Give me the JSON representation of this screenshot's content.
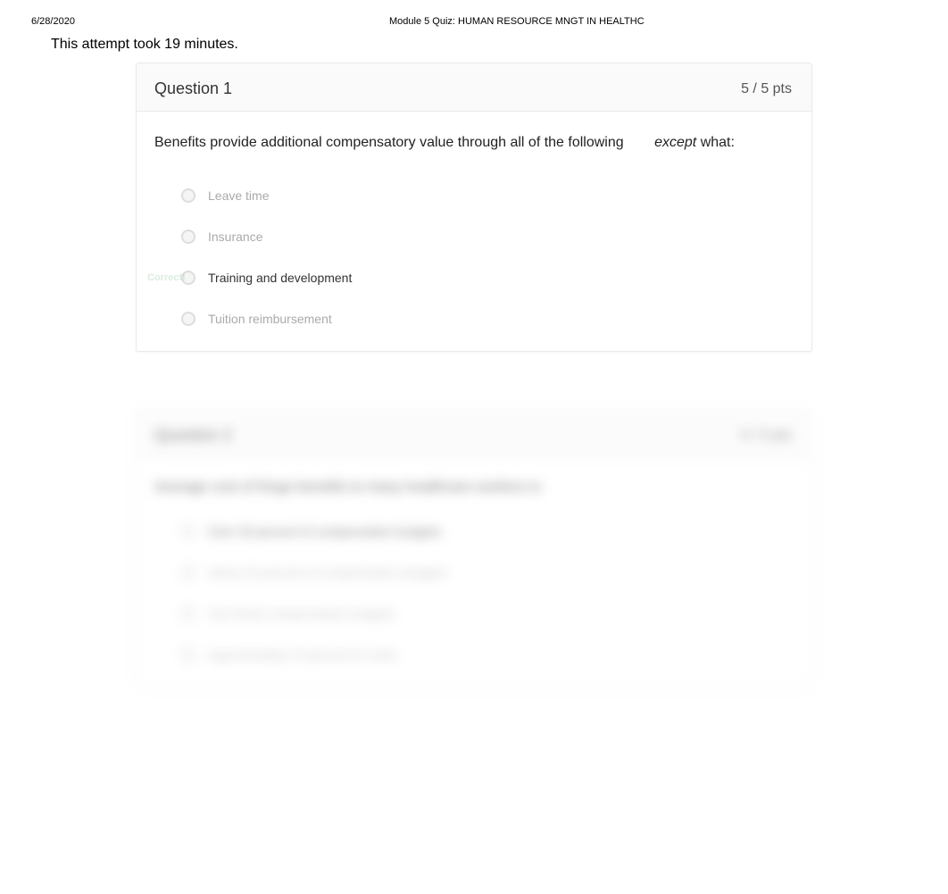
{
  "header": {
    "date": "6/28/2020",
    "title": "Module 5 Quiz: HUMAN RESOURCE MNGT IN HEALTHC"
  },
  "attempt_text": "This attempt took 19 minutes.",
  "questions": [
    {
      "title": "Question 1",
      "points": "5 / 5 pts",
      "text_prefix": "Benefits provide additional compensatory value through all of the following",
      "text_except": "except",
      "text_suffix": " what:",
      "options": [
        {
          "label": "Leave time",
          "correct": false
        },
        {
          "label": "Insurance",
          "correct": false
        },
        {
          "label": "Training and development",
          "correct": true
        },
        {
          "label": "Tuition reimbursement",
          "correct": false
        }
      ],
      "correct_label": "Correct!"
    },
    {
      "title": "Question 2",
      "points": "5 / 5 pts",
      "text": "Average cost of fringe benefits to many healthcare workers is",
      "options": [
        {
          "label": "Over 30 percent of compensation budgets",
          "correct": true
        },
        {
          "label": "About 25 percent of compensation budgets",
          "correct": false
        },
        {
          "label": "Two thirds compensation budgets",
          "correct": false
        },
        {
          "label": "Approximately 15 percent of costs",
          "correct": false
        }
      ]
    }
  ]
}
